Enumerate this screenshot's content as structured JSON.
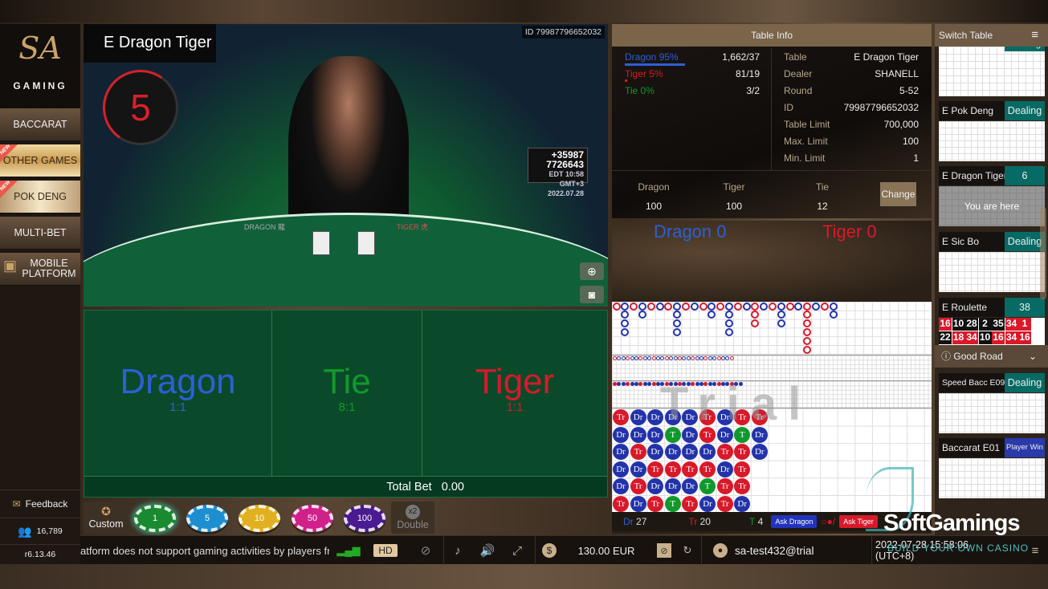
{
  "brand": {
    "logo_text": "SA",
    "logo_sub": "GAMING"
  },
  "sidebar": {
    "items": [
      {
        "label": "BACCARAT"
      },
      {
        "label": "OTHER GAMES",
        "badge": "NEW"
      },
      {
        "label": "POK DENG",
        "badge": "NEW"
      },
      {
        "label": "MULTI-BET"
      },
      {
        "label": "MOBILE PLATFORM"
      }
    ],
    "feedback": "Feedback",
    "online_count": "16,789",
    "version": "r6.13.46"
  },
  "video": {
    "table_title": "E Dragon Tiger",
    "countdown": "5",
    "id_label": "ID 79987796652032",
    "sign": {
      "line1": "+35987",
      "line2": "7726643",
      "tz": "EDT",
      "time": "10:58 GMT+3",
      "date": "2022.07.28"
    },
    "felt_dragon": "DRAGON 龍",
    "felt_tiger": "TIGER 虎"
  },
  "bets": {
    "dragon": {
      "label": "Dragon",
      "odds": "1:1",
      "color": "#2d5fd6"
    },
    "tie": {
      "label": "Tie",
      "odds": "8:1",
      "color": "#11982c"
    },
    "tiger": {
      "label": "Tiger",
      "odds": "1:1",
      "color": "#d8192a"
    },
    "total_label": "Total Bet",
    "total_value": "0.00"
  },
  "chips": {
    "custom": "Custom",
    "values": [
      {
        "v": "1",
        "color": "#1a8a30"
      },
      {
        "v": "5",
        "color": "#1d8fd0"
      },
      {
        "v": "10",
        "color": "#e0b020"
      },
      {
        "v": "50",
        "color": "#d0208a"
      },
      {
        "v": "100",
        "color": "#4a1a90"
      }
    ],
    "double_badge": "x2",
    "double": "Double"
  },
  "bottombar": {
    "marquee": "atform does not support gaming activities by players from (",
    "quality": "HD",
    "balance": "130.00 EUR",
    "username": "sa-test432@trial",
    "datetime": "2022-07-28 15:58:06 (UTC+8)"
  },
  "table_info": {
    "header": "Table Info",
    "stats": [
      {
        "label": "Dragon 95%",
        "value": "1,662/37",
        "color": "#2d5fd6",
        "fill": 0.95
      },
      {
        "label": "Tiger 5%",
        "value": "81/19",
        "color": "#d8192a",
        "fill": 0.05
      },
      {
        "label": "Tie 0%",
        "value": "3/2",
        "color": "#11982c",
        "fill": 0
      }
    ],
    "details": [
      {
        "k": "Table",
        "v": "E Dragon Tiger"
      },
      {
        "k": "Dealer",
        "v": "SHANELL"
      },
      {
        "k": "Round",
        "v": "5-52"
      },
      {
        "k": "ID",
        "v": "79987796652032"
      },
      {
        "k": "Table Limit",
        "v": "700,000"
      },
      {
        "k": "Max. Limit",
        "v": "100"
      },
      {
        "k": "Min. Limit",
        "v": "1"
      }
    ],
    "limits": [
      {
        "k": "Dragon",
        "v": "100"
      },
      {
        "k": "Tiger",
        "v": "100"
      },
      {
        "k": "Tie",
        "v": "12"
      }
    ],
    "change": "Change"
  },
  "road": {
    "dragon_score": "Dragon 0",
    "tiger_score": "Tiger 0",
    "watermark": "Trial",
    "big_road": [
      [
        "R",
        1
      ],
      [
        "B",
        4
      ],
      [
        "R",
        1
      ],
      [
        "B",
        2
      ],
      [
        "R",
        1
      ],
      [
        "B",
        1
      ],
      [
        "R",
        1
      ],
      [
        "B",
        4
      ],
      [
        "R",
        1
      ],
      [
        "B",
        1
      ],
      [
        "R",
        1
      ],
      [
        "B",
        2
      ],
      [
        "R",
        1
      ],
      [
        "B",
        4
      ],
      [
        "R",
        1
      ],
      [
        "B",
        1
      ],
      [
        "R",
        3
      ],
      [
        "B",
        1
      ],
      [
        "R",
        1
      ],
      [
        "B",
        3
      ],
      [
        "R",
        1
      ],
      [
        "B",
        1
      ],
      [
        "R",
        6
      ],
      [
        "B",
        1
      ],
      [
        "R",
        1
      ],
      [
        "B",
        2
      ]
    ],
    "bead_rows": [
      [
        "Tr",
        "Dr",
        "Dr",
        "Dr",
        "Dr",
        "Tr",
        "Dr",
        "Tr",
        "Tr"
      ],
      [
        "Dr",
        "Dr",
        "Dr",
        "T",
        "Dr",
        "Tr",
        "Dr",
        "T",
        "Dr"
      ],
      [
        "Dr",
        "Tr",
        "Dr",
        "Dr",
        "Dr",
        "Dr",
        "Tr",
        "Tr",
        "Dr"
      ],
      [
        "Dr",
        "Dr",
        "Tr",
        "Tr",
        "Tr",
        "Tr",
        "Dr",
        "Tr"
      ],
      [
        "Dr",
        "Tr",
        "Dr",
        "Dr",
        "Dr",
        "T",
        "Tr",
        "Tr"
      ],
      [
        "Tr",
        "Dr",
        "Tr",
        "T",
        "Tr",
        "Dr",
        "Tr",
        "Dr"
      ]
    ],
    "counts": {
      "dr_label": "Dr",
      "dr": "27",
      "tr_label": "Tr",
      "tr": "20",
      "t_label": "T",
      "t": "4"
    },
    "ask_dragon": "Ask Dragon",
    "ask_tiger": "Ask Tiger"
  },
  "switch_table": {
    "header": "Switch Table",
    "tables": [
      {
        "name": "E Pok Deng",
        "status": "Dealing"
      },
      {
        "name": "E Dragon Tiger",
        "status": "6",
        "overlay": "You are here"
      },
      {
        "name": "E Sic Bo",
        "status": "Dealing"
      },
      {
        "name": "E Roulette",
        "status": "38",
        "numbers": [
          [
            "16",
            "10",
            "28",
            "2",
            "35",
            "34",
            "1"
          ],
          [
            "22",
            "18",
            "34",
            "10",
            "16",
            "34",
            "16"
          ]
        ]
      }
    ],
    "top_partial_status": "Dealing",
    "good_road": "Good Road",
    "good_tables": [
      {
        "name": "Speed Bacc E09",
        "status": "Dealing"
      },
      {
        "name": "Baccarat E01",
        "status": "Player Win"
      }
    ]
  },
  "watermark": {
    "name": "SoftGamings",
    "tagline": "BUILD YOUR OWN CASINO"
  }
}
